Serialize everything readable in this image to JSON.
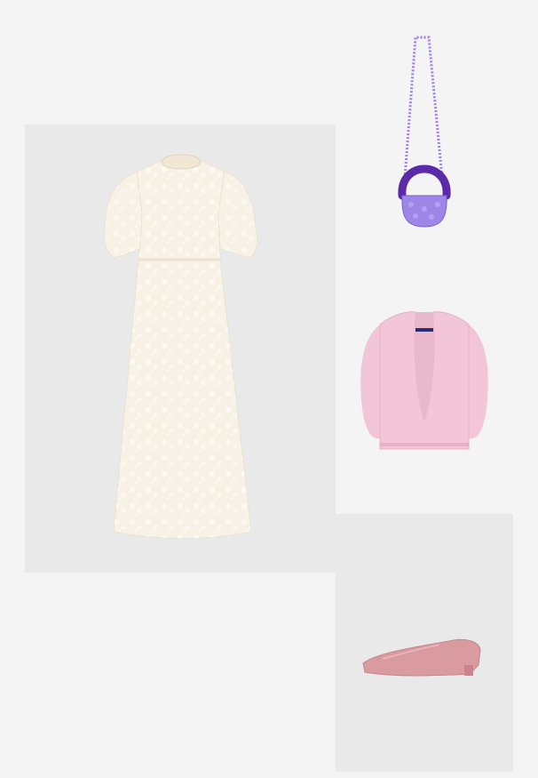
{
  "board": {
    "background": "#f4f4f4",
    "panel_color": "#e9e9e9"
  },
  "items": {
    "dress": {
      "icon": "cream-lace-midi-dress-image",
      "color": "#f7f1e4"
    },
    "bag": {
      "icon": "purple-beaded-bucket-bag-image",
      "color": "#8a63d6"
    },
    "cardigan": {
      "icon": "pink-chunky-knit-cardigan-image",
      "color": "#f2c6d8"
    },
    "shoe": {
      "icon": "pink-pointed-ballet-flat-image",
      "color": "#d99aa0"
    }
  }
}
